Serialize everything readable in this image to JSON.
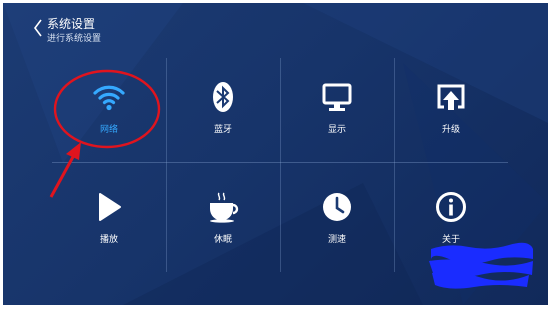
{
  "header": {
    "title": "系统设置",
    "subtitle": "进行系统设置"
  },
  "tiles": [
    {
      "label": "网络",
      "icon": "wifi-icon",
      "active": true
    },
    {
      "label": "蓝牙",
      "icon": "bluetooth-icon",
      "active": false
    },
    {
      "label": "显示",
      "icon": "monitor-icon",
      "active": false
    },
    {
      "label": "升级",
      "icon": "upgrade-icon",
      "active": false
    },
    {
      "label": "播放",
      "icon": "play-icon",
      "active": false
    },
    {
      "label": "休眠",
      "icon": "coffee-cup-icon",
      "active": false
    },
    {
      "label": "测速",
      "icon": "clock-icon",
      "active": false
    },
    {
      "label": "关于",
      "icon": "info-icon",
      "active": false
    }
  ],
  "colors": {
    "background": "#17346a",
    "accent": "#35a9ff",
    "annotation": "#e0141e",
    "redaction": "#1a2cff"
  }
}
